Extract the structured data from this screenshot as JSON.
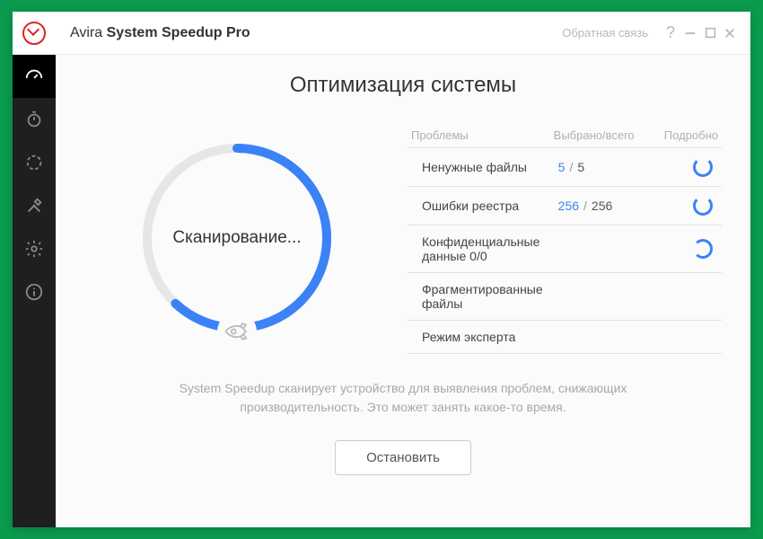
{
  "titlebar": {
    "brand": "Avira",
    "product": "System Speedup Pro",
    "feedback": "Обратная связь",
    "help": "?"
  },
  "sidebar": {
    "items": [
      {
        "name": "dashboard"
      },
      {
        "name": "timer"
      },
      {
        "name": "scan"
      },
      {
        "name": "tools"
      },
      {
        "name": "settings"
      },
      {
        "name": "info"
      }
    ]
  },
  "page": {
    "title": "Оптимизация системы",
    "scan_label": "Сканирование...",
    "description_line1": "System Speedup сканирует устройство для выявления проблем, снижающих",
    "description_line2": "производительность. Это может занять какое-то время.",
    "stop_button": "Остановить"
  },
  "table": {
    "headers": {
      "problems": "Проблемы",
      "selected": "Выбрано/всего",
      "details": "Подробно"
    },
    "rows": [
      {
        "label": "Ненужные файлы",
        "selected": "5",
        "total": "5",
        "spinner": true
      },
      {
        "label": "Ошибки реестра",
        "selected": "256",
        "total": "256",
        "spinner": true
      },
      {
        "label": "Конфиденциальные данные",
        "selected": "0",
        "total": "0",
        "spinner": true,
        "inline": true
      },
      {
        "label": "Фрагментированные файлы",
        "selected": "",
        "total": "",
        "spinner": false
      },
      {
        "label": "Режим эксперта",
        "selected": "",
        "total": "",
        "spinner": false
      }
    ]
  },
  "progress": {
    "percent": 62
  },
  "colors": {
    "accent": "#3b82f6",
    "brand_red": "#d22"
  }
}
